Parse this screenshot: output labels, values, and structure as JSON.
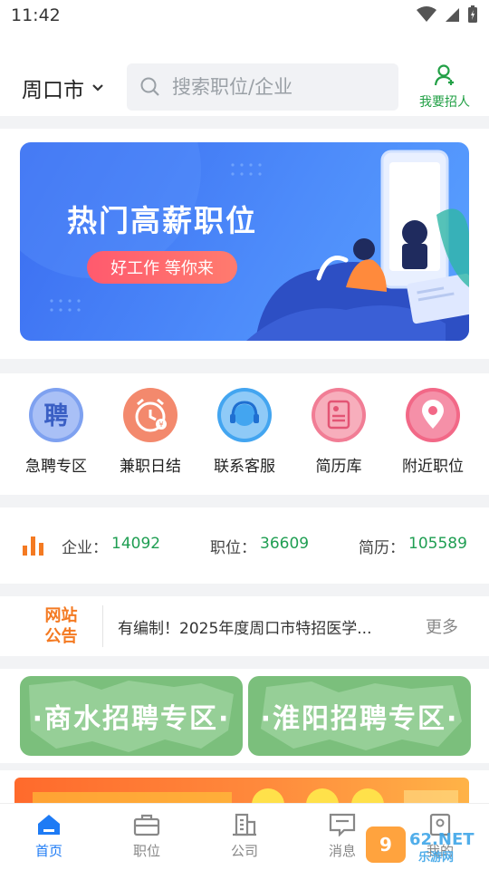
{
  "status_bar": {
    "time": "11:42"
  },
  "header": {
    "city": "周口市",
    "search_placeholder": "搜索职位/企业",
    "recruit_label": "我要招人"
  },
  "banner": {
    "title": "热门高薪职位",
    "pill": "好工作 等你来"
  },
  "quick_links": [
    {
      "label": "急聘专区",
      "icon": "hiring-badge-icon",
      "color": "#7ea1f0"
    },
    {
      "label": "兼职日结",
      "icon": "alarm-clock-icon",
      "color": "#f3896d"
    },
    {
      "label": "联系客服",
      "icon": "headset-icon",
      "color": "#43a5f0"
    },
    {
      "label": "简历库",
      "icon": "resume-document-icon",
      "color": "#f17d95"
    },
    {
      "label": "附近职位",
      "icon": "location-pin-icon",
      "color": "#f26887"
    }
  ],
  "stats": [
    {
      "label": "企业：",
      "value": "14092"
    },
    {
      "label": "职位：",
      "value": "36609"
    },
    {
      "label": "简历：",
      "value": "105589"
    }
  ],
  "notice": {
    "tag_line1": "网站",
    "tag_line2": "公告",
    "text": "有编制！2025年度周口市特招医学...",
    "more": "更多"
  },
  "zones": [
    {
      "label": "·商水招聘专区·"
    },
    {
      "label": "·淮阳招聘专区·"
    }
  ],
  "tabs": [
    {
      "label": "首页",
      "active": true
    },
    {
      "label": "职位",
      "active": false
    },
    {
      "label": "公司",
      "active": false
    },
    {
      "label": "消息",
      "active": false
    },
    {
      "label": "我的",
      "active": false
    }
  ],
  "watermark": {
    "text1": "962",
    "text2": ".NET",
    "text3": "乐游网"
  },
  "colors": {
    "accent_green": "#1f9e52",
    "accent_blue": "#1e7bf5",
    "notice_orange": "#f47a22",
    "zone_green": "#7bbf7c"
  }
}
